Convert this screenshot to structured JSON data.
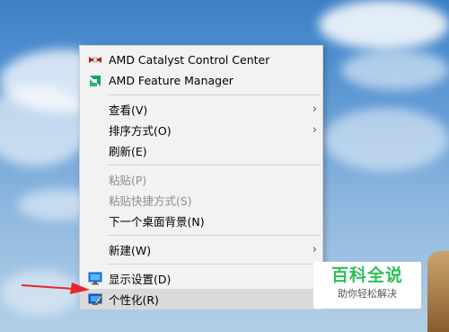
{
  "context_menu": {
    "items": [
      {
        "label": "AMD Catalyst Control Center",
        "icon": "amd-catalyst-icon",
        "enabled": true
      },
      {
        "label": "AMD Feature Manager",
        "icon": "amd-logo-icon",
        "enabled": true
      },
      {
        "label": "查看(V)",
        "submenu": true,
        "enabled": true
      },
      {
        "label": "排序方式(O)",
        "submenu": true,
        "enabled": true
      },
      {
        "label": "刷新(E)",
        "enabled": true
      },
      {
        "label": "粘贴(P)",
        "enabled": false
      },
      {
        "label": "粘贴快捷方式(S)",
        "enabled": false
      },
      {
        "label": "下一个桌面背景(N)",
        "enabled": true
      },
      {
        "label": "新建(W)",
        "submenu": true,
        "enabled": true
      },
      {
        "label": "显示设置(D)",
        "icon": "display-settings-icon",
        "enabled": true
      },
      {
        "label": "个性化(R)",
        "icon": "personalize-icon",
        "enabled": true,
        "highlighted": true
      }
    ]
  },
  "watermark": {
    "title": "百科全说",
    "subtitle": "助你轻松解决"
  },
  "colors": {
    "menu_bg": "#f2f2f2",
    "hover_bg": "#dadada",
    "arrow_red": "#e8262b",
    "watermark_green": "#2fbf5b",
    "amd_green": "#11a65a"
  }
}
